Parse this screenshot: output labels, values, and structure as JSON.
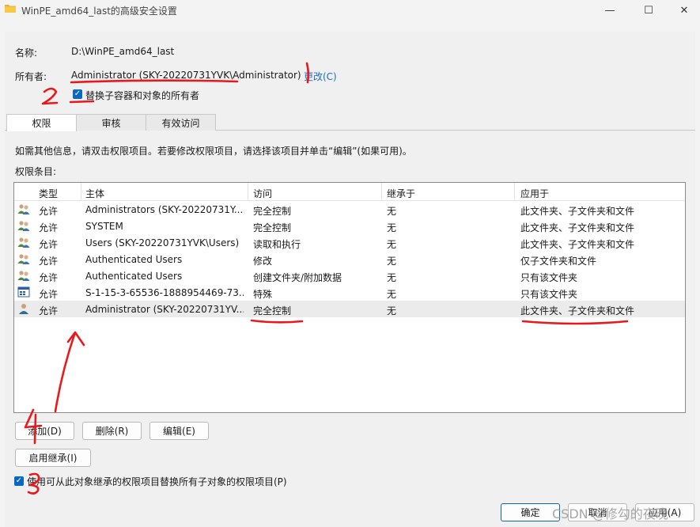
{
  "window": {
    "title": "WinPE_amd64_last的高级安全设置",
    "min_glyph": "—",
    "max_glyph": "☐",
    "close_glyph": "✕"
  },
  "header": {
    "name_label": "名称:",
    "name_value": "D:\\WinPE_amd64_last",
    "owner_label": "所有者:",
    "owner_value": "Administrator (SKY-20220731YVK\\Administrator)",
    "change_link": "更改(C)",
    "replace_owner_label": "替换子容器和对象的所有者",
    "replace_owner_checked": true
  },
  "tabs": [
    {
      "label": "权限",
      "active": true
    },
    {
      "label": "审核",
      "active": false
    },
    {
      "label": "有效访问",
      "active": false
    }
  ],
  "info_text": "如需其他信息，请双击权限项目。若要修改权限项目，请选择该项目并单击“编辑”(如果可用)。",
  "entries_label": "权限条目:",
  "columns": [
    "类型",
    "主体",
    "访问",
    "继承于",
    "应用于"
  ],
  "rows": [
    {
      "icon": "users-group-icon",
      "type": "允许",
      "principal": "Administrators (SKY-20220731Y...",
      "access": "完全控制",
      "inherited": "无",
      "applies": "此文件夹、子文件夹和文件"
    },
    {
      "icon": "users-group-icon",
      "type": "允许",
      "principal": "SYSTEM",
      "access": "完全控制",
      "inherited": "无",
      "applies": "此文件夹、子文件夹和文件"
    },
    {
      "icon": "users-group-icon",
      "type": "允许",
      "principal": "Users (SKY-20220731YVK\\Users)",
      "access": "读取和执行",
      "inherited": "无",
      "applies": "此文件夹、子文件夹和文件"
    },
    {
      "icon": "users-group-icon",
      "type": "允许",
      "principal": "Authenticated Users",
      "access": "修改",
      "inherited": "无",
      "applies": "仅子文件夹和文件"
    },
    {
      "icon": "users-group-icon",
      "type": "允许",
      "principal": "Authenticated Users",
      "access": "创建文件夹/附加数据",
      "inherited": "无",
      "applies": "只有该文件夹"
    },
    {
      "icon": "app-package-icon",
      "type": "允许",
      "principal": "S-1-15-3-65536-1888954469-73...",
      "access": "特殊",
      "inherited": "无",
      "applies": "只有该文件夹"
    },
    {
      "icon": "single-user-icon",
      "type": "允许",
      "principal": "Administrator (SKY-20220731YV...",
      "access": "完全控制",
      "inherited": "无",
      "applies": "此文件夹、子文件夹和文件",
      "selected": true
    }
  ],
  "buttons": {
    "add": "添加(D)",
    "remove": "删除(R)",
    "edit": "编辑(E)",
    "enable_inheritance": "启用继承(I)",
    "ok": "确定",
    "cancel": "取消",
    "apply": "应用(A)"
  },
  "replace_child_label": "使用可从此对象继承的权限项目替换所有子对象的权限项目(P)",
  "replace_child_checked": true,
  "annotations": [
    "1",
    "2",
    "3",
    "4"
  ],
  "watermark": "CSDN @修勾的夜晚",
  "colors": {
    "accent": "#0a67c3",
    "link": "#1a6fd0",
    "annotation": "#e8181c"
  }
}
